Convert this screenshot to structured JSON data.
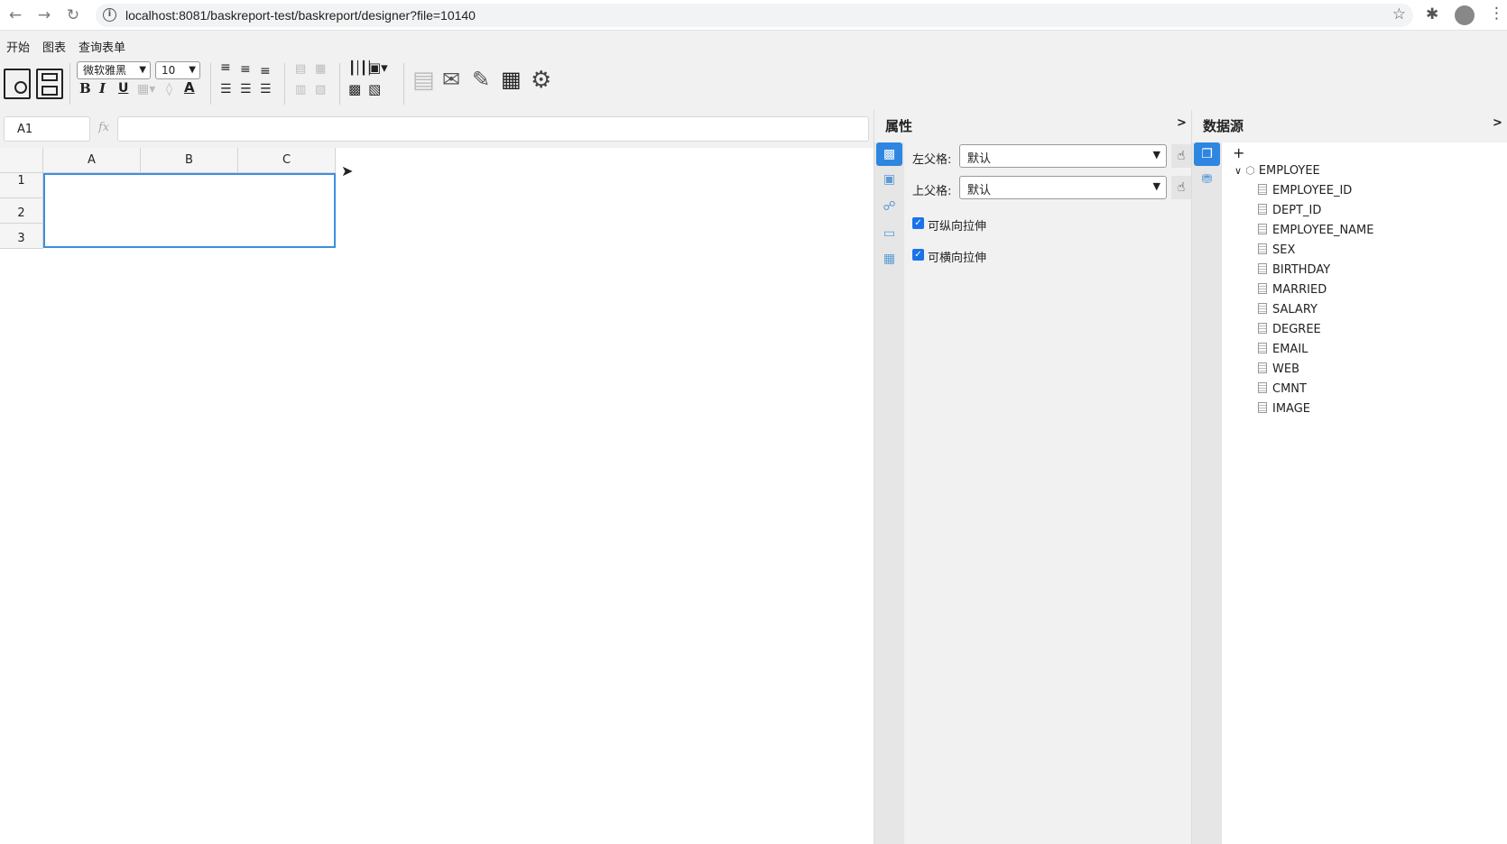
{
  "browser": {
    "url": "localhost:8081/baskreport-test/baskreport/designer?file=10140",
    "back_icon": "arrow-left-icon",
    "forward_icon": "arrow-right-icon",
    "reload_icon": "reload-icon"
  },
  "app_tabs": [
    {
      "label": "开始",
      "active": true
    },
    {
      "label": "图表",
      "active": false
    },
    {
      "label": "查询表单",
      "active": false
    }
  ],
  "toolbar": {
    "font_family": "微软雅黑",
    "font_size": "10",
    "bold": "B",
    "italic": "I",
    "underline": "U",
    "font_color": "A"
  },
  "formula": {
    "cell_ref": "A1",
    "fx": "fx",
    "value": ""
  },
  "grid": {
    "columns": [
      "A",
      "B",
      "C"
    ],
    "rows": [
      "1",
      "2",
      "3"
    ]
  },
  "properties": {
    "title": "属性",
    "collapse": ">",
    "left_parent_label": "左父格:",
    "left_parent_value": "默认",
    "top_parent_label": "上父格:",
    "top_parent_value": "默认",
    "vertical_stretch": "可纵向拉伸",
    "horizontal_stretch": "可横向拉伸"
  },
  "datasource": {
    "title": "数据源",
    "collapse": ">",
    "add": "+",
    "table": "EMPLOYEE",
    "fields": [
      "EMPLOYEE_ID",
      "DEPT_ID",
      "EMPLOYEE_NAME",
      "SEX",
      "BIRTHDAY",
      "MARRIED",
      "SALARY",
      "DEGREE",
      "EMAIL",
      "WEB",
      "CMNT",
      "IMAGE"
    ]
  },
  "colors": {
    "accent": "#2f86e0",
    "selection": "#3d8ee0",
    "checkbox": "#1a73e8"
  }
}
